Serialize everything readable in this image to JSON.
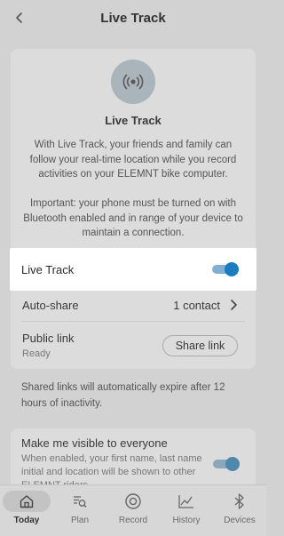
{
  "header": {
    "title": "Live Track"
  },
  "info": {
    "title": "Live Track",
    "body": "With Live Track, your friends and family can follow your real-time location while you record activities on your ELEMNT bike computer.",
    "important": "Important: your phone must be turned on with Bluetooth enabled and in range of your device to maintain a connection."
  },
  "live_track": {
    "label": "Live Track",
    "enabled": true
  },
  "auto_share": {
    "label": "Auto-share",
    "value": "1 contact"
  },
  "public_link": {
    "label": "Public link",
    "status": "Ready",
    "button": "Share link"
  },
  "expire_note": "Shared links will automatically expire after 12 hours of inactivity.",
  "visibility": {
    "title": "Make me visible to everyone",
    "description": "When enabled, your first name, last name initial and location will be shown to other ELEMNT riders.",
    "enabled": true
  },
  "nav": {
    "items": [
      {
        "label": "Today",
        "icon": "home-icon",
        "active": true
      },
      {
        "label": "Plan",
        "icon": "plan-search-icon",
        "active": false
      },
      {
        "label": "Record",
        "icon": "record-icon",
        "active": false
      },
      {
        "label": "History",
        "icon": "history-chart-icon",
        "active": false
      },
      {
        "label": "Devices",
        "icon": "bluetooth-icon",
        "active": false
      }
    ]
  },
  "colors": {
    "accent": "#1b7cc4",
    "background": "#d2d2d2",
    "highlight": "#ffffff"
  }
}
